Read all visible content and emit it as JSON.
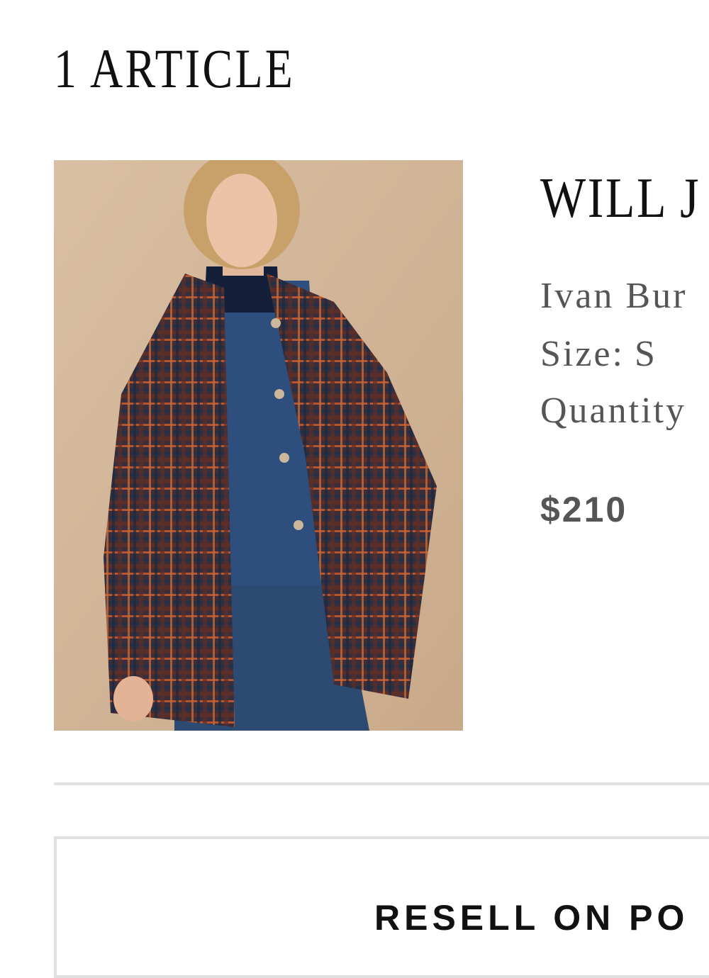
{
  "cart": {
    "heading": "1 ARTICLE",
    "item": {
      "name": "WILL J",
      "color_label": "Ivan Bur",
      "size_label": "Size:",
      "size_value": "S",
      "quantity_label": "Quantity",
      "price": "$210",
      "image_alt": "Woman wearing a plaid quilted jacket over a denim shirt"
    },
    "resell_label": "RESELL ON PO"
  },
  "colors": {
    "background": "#ffffff",
    "heading_text": "#111111",
    "secondary_text": "#555555",
    "divider": "#e2e2e2"
  }
}
